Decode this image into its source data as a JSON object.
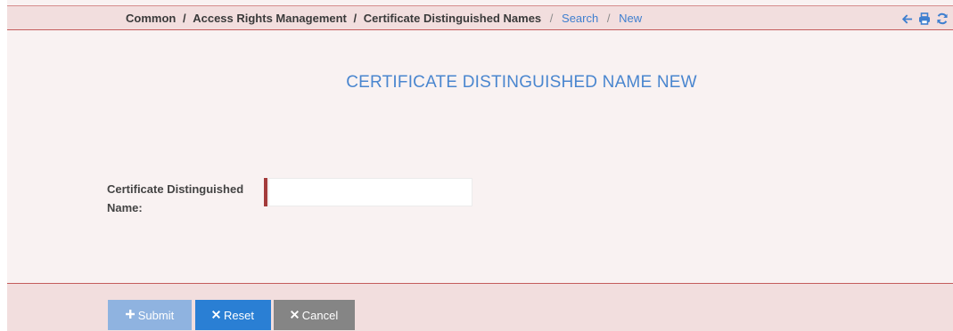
{
  "breadcrumb": {
    "static": [
      "Common",
      "Access Rights Management",
      "Certificate Distinguished Names"
    ],
    "links": [
      "Search",
      "New"
    ],
    "separator": "/"
  },
  "toolbar": {
    "icons": [
      "arrow-left-icon",
      "print-icon",
      "refresh-icon"
    ],
    "icon_color": "#3f7fcf"
  },
  "page": {
    "title": "CERTIFICATE DISTINGUISHED NAME NEW"
  },
  "form": {
    "fields": [
      {
        "label": "Certificate Distinguished Name:",
        "value": "",
        "placeholder": "",
        "required": true
      }
    ]
  },
  "actions": {
    "submit_label": "Submit",
    "submit_icon": "plus-icon",
    "reset_label": "Reset",
    "reset_icon": "times-icon",
    "cancel_label": "Cancel",
    "cancel_icon": "times-icon"
  },
  "colors": {
    "accent": "#3f7fcf",
    "header_bg": "#f2dede",
    "body_bg": "#f9f2f2",
    "required_marker": "#a33b3b",
    "submit_bg": "#8fb3e0",
    "reset_bg": "#2a7fd4",
    "cancel_bg": "#858585"
  }
}
